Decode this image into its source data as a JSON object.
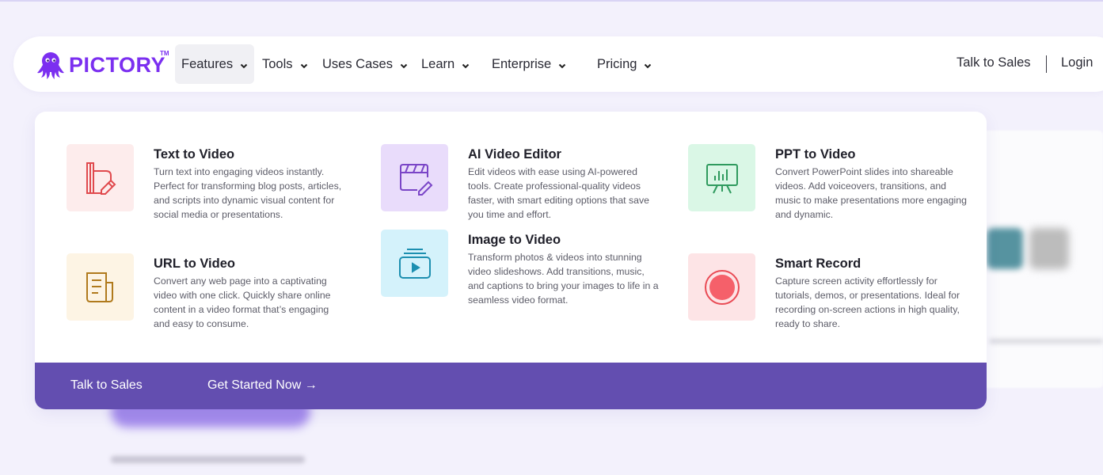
{
  "brand": {
    "name": "PICTORY",
    "tm": "TM",
    "color": "#7b2ff0"
  },
  "nav": {
    "items": [
      {
        "label": "Features",
        "active": true
      },
      {
        "label": "Tools"
      },
      {
        "label": "Uses Cases"
      },
      {
        "label": "Learn"
      },
      {
        "label": "Enterprise"
      },
      {
        "label": "Pricing"
      }
    ],
    "talk_to_sales": "Talk to Sales",
    "login": "Login"
  },
  "features": {
    "text_to_video": {
      "title": "Text to Video",
      "desc": "Turn text into engaging videos instantly. Perfect for transforming blog posts, articles, and scripts into dynamic visual content for social media or presentations.",
      "icon": "text-edit-icon",
      "tile_color": "#fdecec"
    },
    "url_to_video": {
      "title": "URL to Video",
      "desc": "Convert any web page into a captivating video with one click. Quickly share online content in a video format that’s engaging and easy to consume.",
      "icon": "document-icon",
      "tile_color": "#fdf4e4"
    },
    "ai_video_editor": {
      "title": "AI Video Editor",
      "desc": "Edit videos with ease using AI-powered tools. Create professional-quality videos faster, with smart editing options that save you time and effort.",
      "icon": "clapper-edit-icon",
      "tile_color": "#e9dcfb"
    },
    "image_to_video": {
      "title": "Image to Video",
      "desc": "Transform photos & videos into stunning video slideshows. Add transitions, music, and captions to bring your images to life in a seamless video format.",
      "icon": "media-stack-icon",
      "tile_color": "#d4f2fb"
    },
    "ppt_to_video": {
      "title": "PPT to Video",
      "desc": "Convert PowerPoint slides into shareable videos. Add voiceovers, transitions, and music to make presentations more engaging and dynamic.",
      "icon": "presentation-icon",
      "tile_color": "#daf7e6"
    },
    "smart_record": {
      "title": "Smart Record",
      "desc": "Capture screen activity effortlessly for tutorials, demos, or presentations. Ideal for recording on-screen actions in high quality, ready to share.",
      "icon": "record-icon",
      "tile_color": "#fde4e6"
    }
  },
  "footer": {
    "talk_to_sales": "Talk to Sales",
    "get_started": "Get Started Now →",
    "color": "#634eb0"
  }
}
